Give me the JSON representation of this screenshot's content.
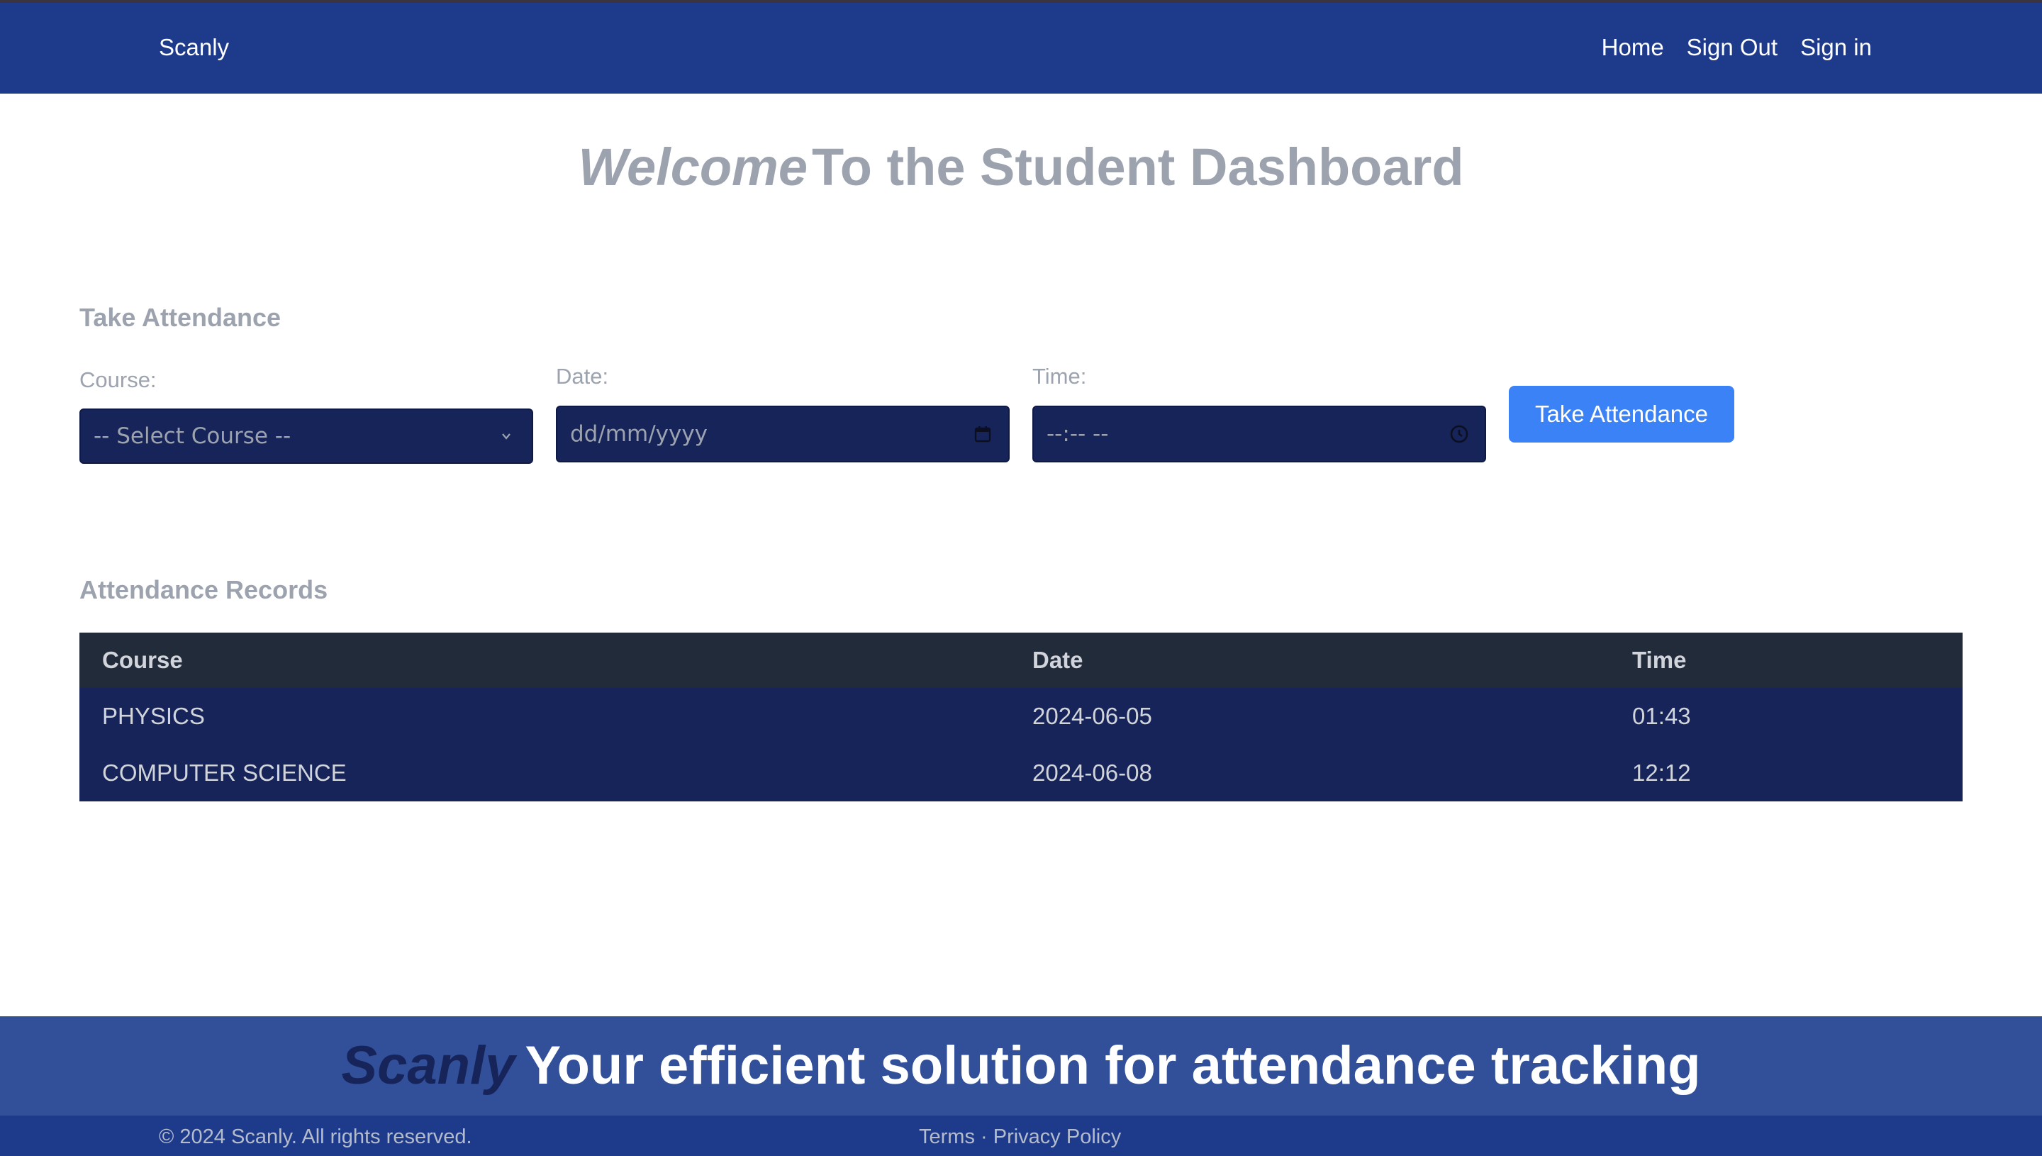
{
  "navbar": {
    "brand": "Scanly",
    "links": [
      "Home",
      "Sign Out",
      "Sign in"
    ]
  },
  "hero": {
    "welcome_em": "Welcome",
    "welcome_rest": "To the Student Dashboard"
  },
  "attendance_form": {
    "title": "Take Attendance",
    "course_label": "Course:",
    "course_selected": "-- Select Course --",
    "date_label": "Date:",
    "date_placeholder": "dd/mm/yyyy",
    "time_label": "Time:",
    "time_placeholder": "--:-- --",
    "submit_label": "Take Attendance"
  },
  "records": {
    "title": "Attendance Records",
    "columns": [
      "Course",
      "Date",
      "Time"
    ],
    "rows": [
      [
        "PHYSICS",
        "2024-06-05",
        "01:43"
      ],
      [
        "COMPUTER SCIENCE",
        "2024-06-08",
        "12:12"
      ]
    ]
  },
  "tagline": {
    "brand": "Scanly",
    "text": "Your efficient solution for attendance tracking"
  },
  "footer": {
    "copyright": "© 2024 Scanly. All rights reserved.",
    "terms": "Terms",
    "separator": " · ",
    "privacy": "Privacy Policy"
  },
  "icons": {
    "select_arrow": "chevron-down-icon",
    "date_picker": "calendar-icon",
    "time_picker": "clock-icon"
  },
  "colors": {
    "navbar": "#1e3a8a",
    "button": "#3b82f6",
    "input_bg": "#16245a",
    "table_header": "#222b3a",
    "muted_text": "#9ca3af",
    "tagline_bg": "#324f99"
  }
}
